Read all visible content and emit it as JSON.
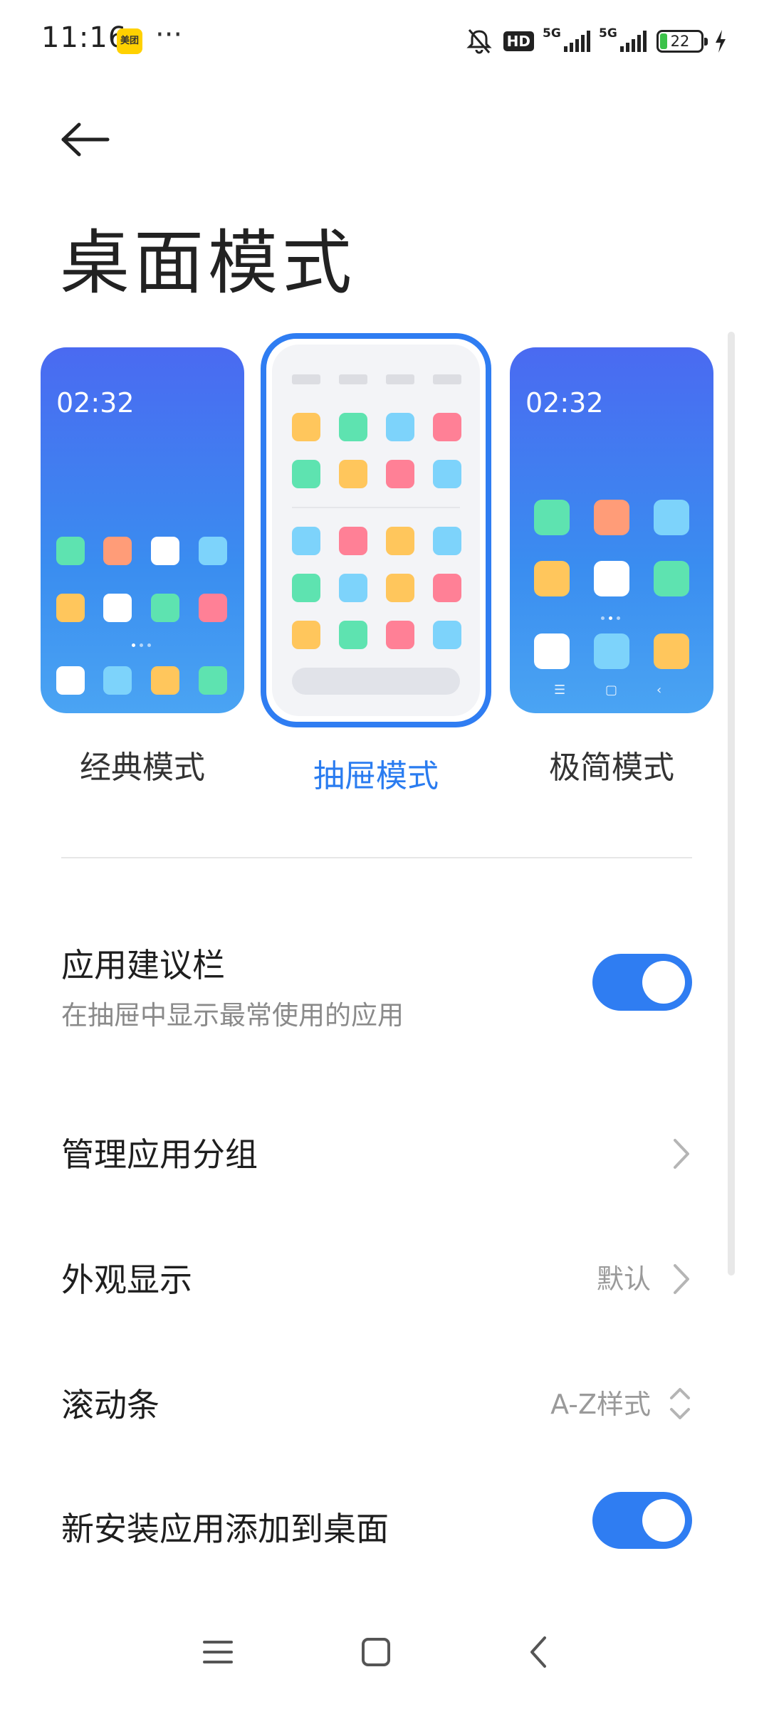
{
  "status_bar": {
    "time": "11:16",
    "app_badge": "美团",
    "more": "···",
    "hd": "HD",
    "signal1_label": "5G",
    "signal2_label": "5G",
    "battery": "22"
  },
  "page": {
    "title": "桌面模式"
  },
  "modes": [
    {
      "label": "经典模式",
      "clock": "02:32",
      "selected": false
    },
    {
      "label": "抽屉模式",
      "selected": true
    },
    {
      "label": "极简模式",
      "clock": "02:32",
      "selected": false
    }
  ],
  "settings": {
    "suggestion_bar": {
      "title": "应用建议栏",
      "subtitle": "在抽屉中显示最常使用的应用",
      "enabled": true
    },
    "manage_groups": {
      "title": "管理应用分组"
    },
    "appearance": {
      "title": "外观显示",
      "value": "默认"
    },
    "scrollbar": {
      "title": "滚动条",
      "value": "A-Z样式"
    },
    "add_new_apps": {
      "title": "新安装应用添加到桌面",
      "enabled": true
    }
  },
  "colors": {
    "accent": "#2f7df2",
    "tile_yellow": "#FFC65C",
    "tile_green": "#5EE3B0",
    "tile_blue": "#7DD3FB",
    "tile_red": "#FF8096",
    "tile_orange": "#FF9C78"
  }
}
